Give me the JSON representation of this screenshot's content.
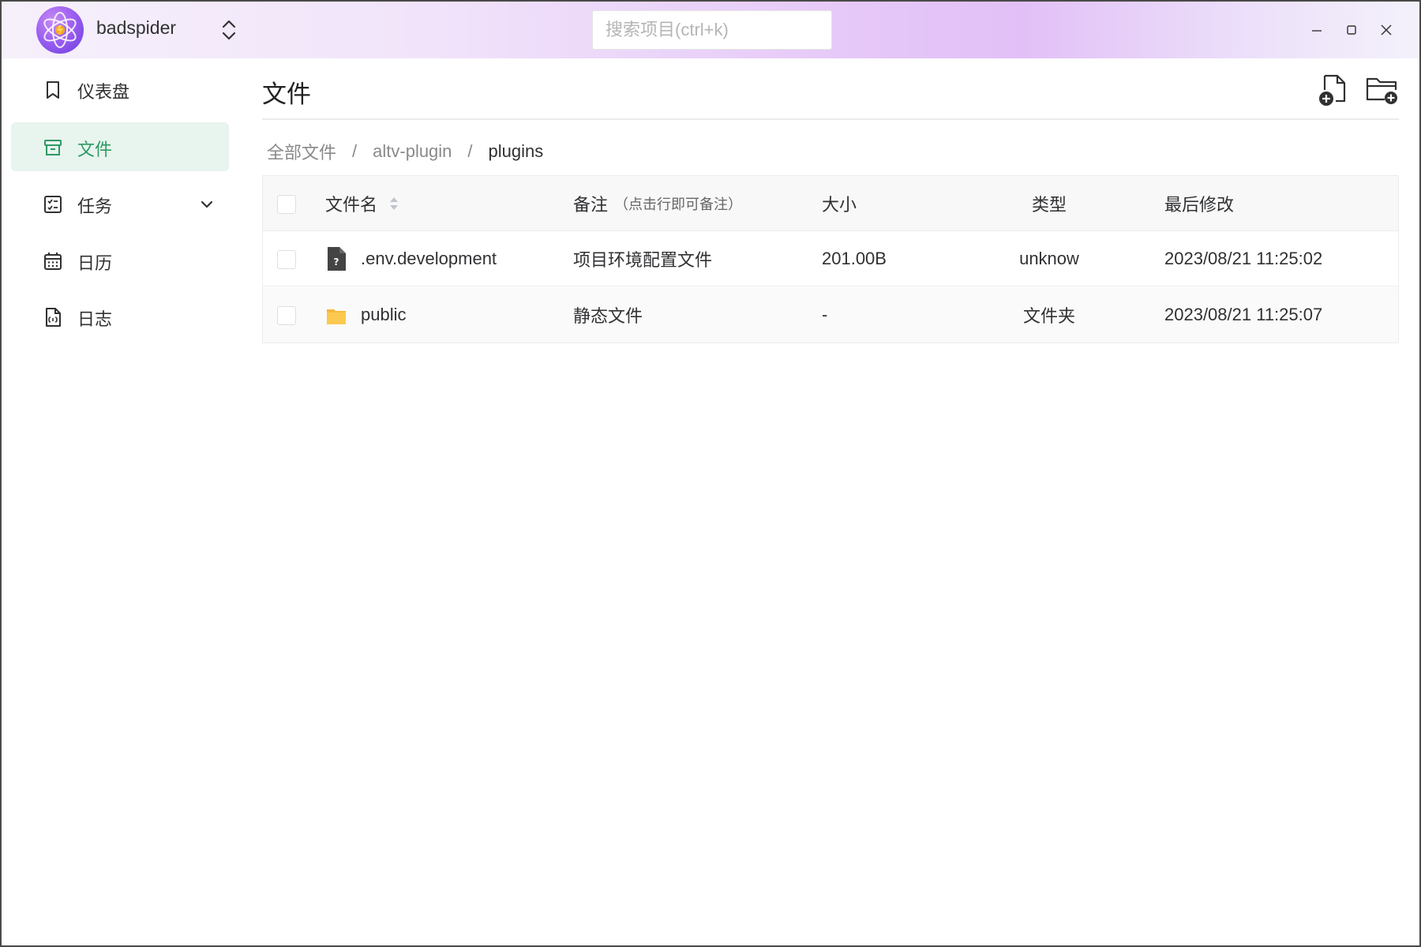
{
  "app": {
    "name": "badspider",
    "search_placeholder": "搜索项目(ctrl+k)"
  },
  "window_controls": [
    "minimize-icon",
    "maximize-icon",
    "close-icon"
  ],
  "sidebar": {
    "items": [
      {
        "label": "仪表盘",
        "icon": "bookmark-icon",
        "active": false
      },
      {
        "label": "文件",
        "icon": "archive-icon",
        "active": true
      },
      {
        "label": "任务",
        "icon": "task-list-icon",
        "active": false,
        "expandable": true
      },
      {
        "label": "日历",
        "icon": "calendar-icon",
        "active": false
      },
      {
        "label": "日志",
        "icon": "log-file-icon",
        "active": false
      }
    ]
  },
  "main": {
    "title": "文件",
    "actions": [
      "new-file-icon",
      "new-folder-icon"
    ],
    "breadcrumb": [
      "全部文件",
      "altv-plugin",
      "plugins"
    ],
    "table": {
      "columns": {
        "name": "文件名",
        "note": "备注",
        "note_hint": "（点击行即可备注）",
        "size": "大小",
        "type": "类型",
        "modified": "最后修改"
      },
      "rows": [
        {
          "icon": "unknown-file-icon",
          "name": ".env.development",
          "note": "项目环境配置文件",
          "size": "201.00B",
          "type": "unknow",
          "modified": "2023/08/21 11:25:02"
        },
        {
          "icon": "folder-icon",
          "name": "public",
          "note": "静态文件",
          "size": "-",
          "type": "文件夹",
          "modified": "2023/08/21 11:25:07"
        }
      ]
    }
  },
  "colors": {
    "accent": "#2e9a63",
    "active_bg": "#e8f4ee",
    "folder": "#fbc94e"
  }
}
